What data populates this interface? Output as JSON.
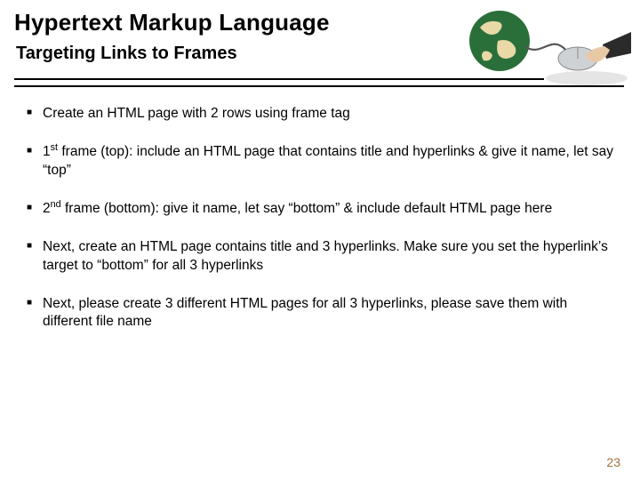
{
  "header": {
    "title": "Hypertext Markup Language",
    "subtitle": "Targeting Links to Frames"
  },
  "bullets": [
    "Create an HTML page with 2 rows using frame tag",
    "1st frame (top): include an HTML page that contains title and hyperlinks & give it name, let say “top”",
    "2nd frame (bottom): give it name, let say “bottom” & include default HTML page here",
    "Next, create an HTML page contains title and 3 hyperlinks. Make sure you set the hyperlink’s target to “bottom” for all 3 hyperlinks",
    "Next, please create 3 different HTML pages for all 3 hyperlinks, please save them with different file name"
  ],
  "slide_number": "23"
}
